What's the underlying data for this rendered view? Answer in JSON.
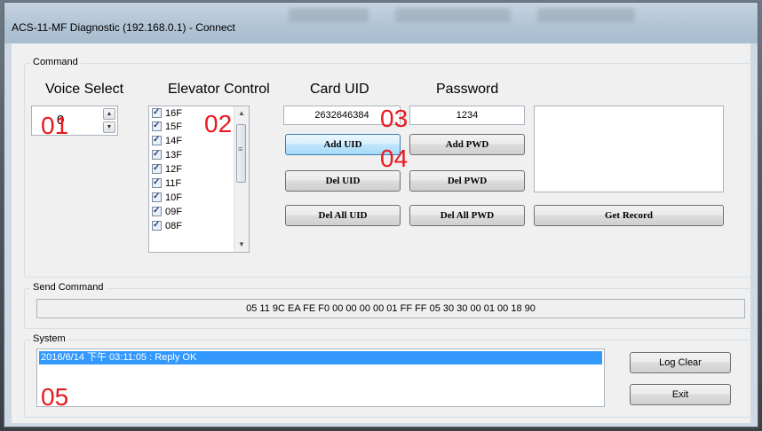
{
  "window": {
    "title": "ACS-11-MF Diagnostic (192.168.0.1) - Connect"
  },
  "command_group": {
    "caption": "Command",
    "voice_select": {
      "header": "Voice Select",
      "value": "0"
    },
    "elevator_control": {
      "header": "Elevator Control",
      "floors": [
        "16F",
        "15F",
        "14F",
        "13F",
        "12F",
        "11F",
        "10F",
        "09F",
        "08F"
      ]
    },
    "card_uid": {
      "header": "Card UID",
      "value": "2632646384",
      "add_label": "Add UID",
      "del_label": "Del UID",
      "del_all_label": "Del All UID"
    },
    "password": {
      "header": "Password",
      "value": "1234",
      "add_label": "Add PWD",
      "del_label": "Del PWD",
      "del_all_label": "Del All PWD"
    },
    "get_record_label": "Get Record"
  },
  "send_command": {
    "caption": "Send Command",
    "value": "05 11 9C EA FE F0 00 00 00 00 01 FF FF 05 30 30 00 01 00 18 90"
  },
  "system": {
    "caption": "System",
    "log_lines": [
      "2016/6/14 下午 03:11:05 : Reply OK"
    ],
    "log_clear_label": "Log Clear",
    "exit_label": "Exit"
  },
  "annotations": [
    "01",
    "02",
    "03",
    "04",
    "05"
  ],
  "colors": {
    "annotation": "#e8191e",
    "selection": "#3399ff"
  }
}
